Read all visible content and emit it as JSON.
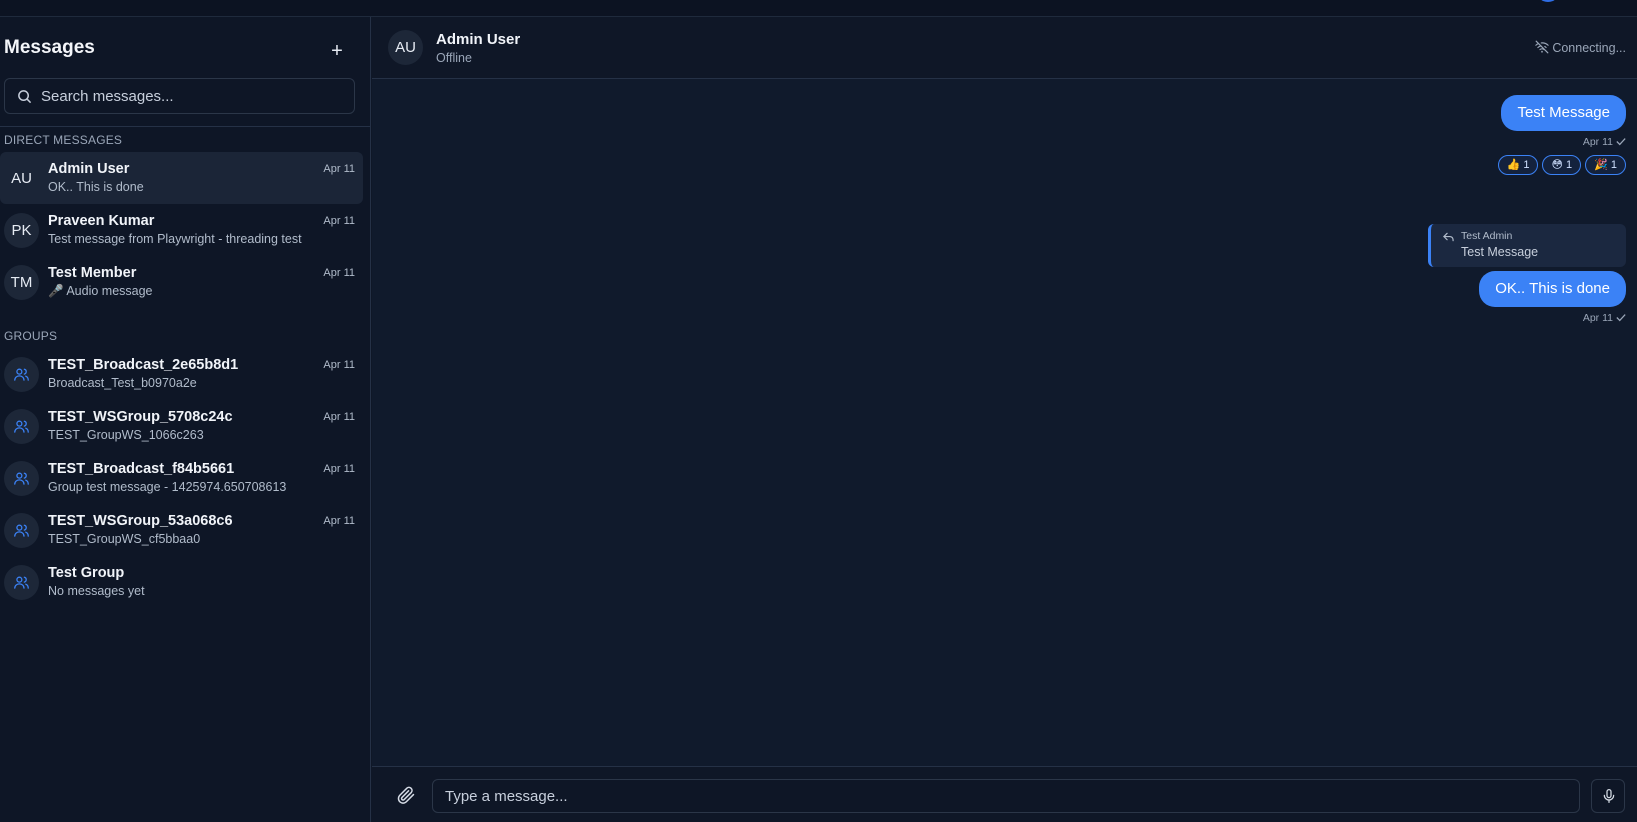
{
  "sidebar": {
    "title": "Messages",
    "add_label": "+",
    "search_placeholder": "Search messages...",
    "direct_label": "DIRECT MESSAGES",
    "groups_label": "GROUPS",
    "direct": [
      {
        "initials": "AU",
        "name": "Admin User",
        "preview": "OK.. This is done",
        "date": "Apr 11"
      },
      {
        "initials": "PK",
        "name": "Praveen Kumar",
        "preview": "Test message from Playwright - threading test",
        "date": "Apr 11"
      },
      {
        "initials": "TM",
        "name": "Test Member",
        "preview": "🎤 Audio message",
        "date": "Apr 11"
      }
    ],
    "groups": [
      {
        "name": "TEST_Broadcast_2e65b8d1",
        "preview": "Broadcast_Test_b0970a2e",
        "date": "Apr 11"
      },
      {
        "name": "TEST_WSGroup_5708c24c",
        "preview": "TEST_GroupWS_1066c263",
        "date": "Apr 11"
      },
      {
        "name": "TEST_Broadcast_f84b5661",
        "preview": "Group test message - 1425974.650708613",
        "date": "Apr 11"
      },
      {
        "name": "TEST_WSGroup_53a068c6",
        "preview": "TEST_GroupWS_cf5bbaa0",
        "date": "Apr 11"
      },
      {
        "name": "Test Group",
        "preview": "No messages yet",
        "date": ""
      }
    ]
  },
  "chat": {
    "initials": "AU",
    "name": "Admin User",
    "status": "Offline",
    "connection": "Connecting...",
    "messages": [
      {
        "text": "Test Message",
        "date": "Apr 11"
      },
      {
        "text": "OK.. This is done",
        "date": "Apr 11"
      }
    ],
    "reactions": [
      {
        "emoji": "👍",
        "count": "1"
      },
      {
        "emoji": "😳",
        "count": "1"
      },
      {
        "emoji": "🎉",
        "count": "1"
      }
    ],
    "reply": {
      "author": "Test Admin",
      "text": "Test Message"
    },
    "composer_placeholder": "Type a message..."
  },
  "colors": {
    "accent": "#3b82f6",
    "background": "#0f1727"
  }
}
